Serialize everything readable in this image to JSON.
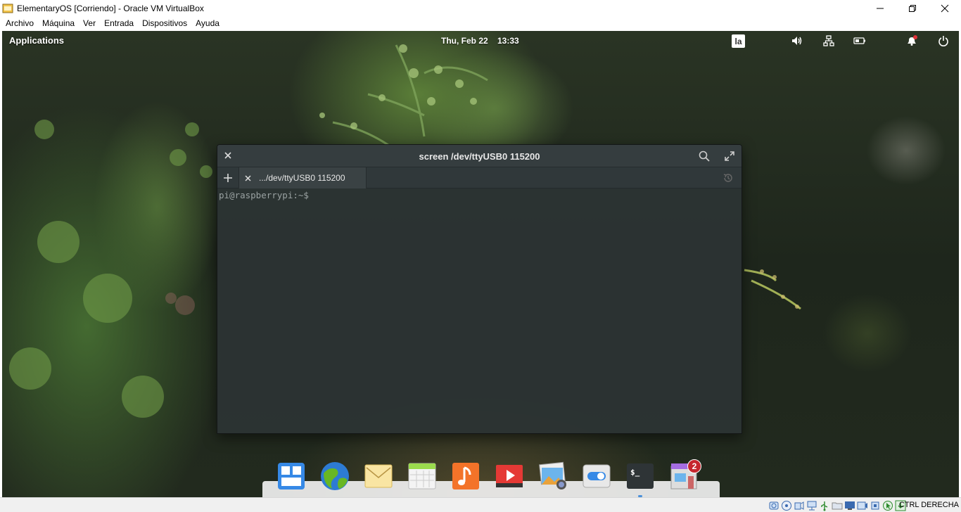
{
  "window": {
    "title": "ElementaryOS [Corriendo] - Oracle VM VirtualBox",
    "menu": [
      "Archivo",
      "Máquina",
      "Ver",
      "Entrada",
      "Dispositivos",
      "Ayuda"
    ]
  },
  "panel": {
    "applications": "Applications",
    "clock": "Thu, Feb 22    13:33",
    "keyboard_layout": "la"
  },
  "terminal": {
    "title": "screen /dev/ttyUSB0 115200",
    "tab_label": ".../dev/ttyUSB0 115200",
    "prompt": "pi@raspberrypi:~$"
  },
  "dock": {
    "items": [
      "multitasking-view",
      "web-browser",
      "mail",
      "calendar",
      "music",
      "videos",
      "photos",
      "system-settings",
      "terminal",
      "appcenter"
    ],
    "appcenter_badge": "2"
  },
  "statusbar": {
    "host_key": "CTRL DERECHA"
  },
  "colors": {
    "accent": "#4a90d9",
    "badge": "#c6262e",
    "terminal_bg": "#2c3434"
  }
}
